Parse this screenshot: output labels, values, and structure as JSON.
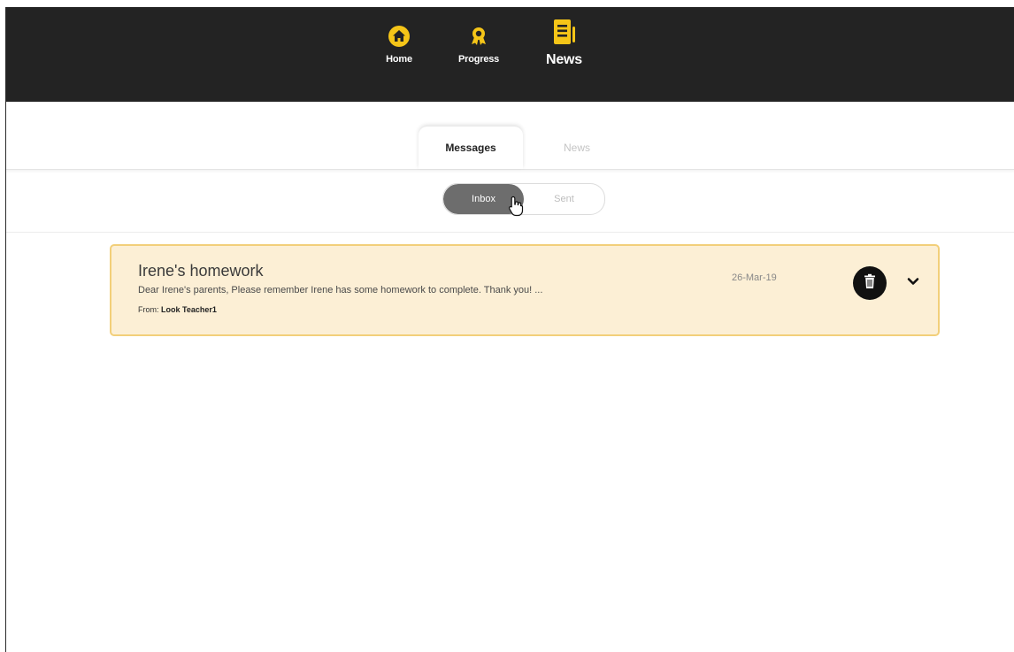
{
  "nav": {
    "items": [
      {
        "label": "Home",
        "icon": "home-icon"
      },
      {
        "label": "Progress",
        "icon": "award-icon"
      },
      {
        "label": "News",
        "icon": "newspaper-icon"
      }
    ],
    "active": "News"
  },
  "tabs": [
    {
      "label": "Messages",
      "active": true
    },
    {
      "label": "News",
      "active": false
    }
  ],
  "toggle": {
    "inbox_label": "Inbox",
    "sent_label": "Sent",
    "selected": "Inbox"
  },
  "messages": [
    {
      "subject": "Irene's homework",
      "preview": "Dear Irene's parents, Please remember Irene has some homework to complete. Thank you! ...",
      "from_prefix": "From:",
      "from_name": "Look Teacher1",
      "date": "26-Mar-19"
    }
  ],
  "colors": {
    "topbar": "#232323",
    "accent": "#f5c518",
    "card_bg": "#fcefd5",
    "card_border": "#f2cf7a",
    "toggle_active": "#6d6d6d"
  }
}
